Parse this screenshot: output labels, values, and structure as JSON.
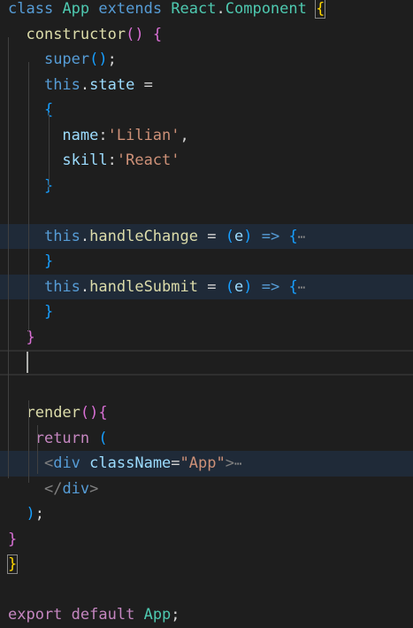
{
  "editor": {
    "lines": [
      [
        [
          "kw-blue",
          "class"
        ],
        [
          "pun",
          " "
        ],
        [
          "cls",
          "App"
        ],
        [
          "pun",
          " "
        ],
        [
          "kw-blue",
          "extends"
        ],
        [
          "pun",
          " "
        ],
        [
          "cls",
          "React"
        ],
        [
          "pun",
          "."
        ],
        [
          "cls",
          "Component"
        ],
        [
          "pun",
          " "
        ],
        [
          "br1 box",
          "{"
        ]
      ],
      [
        [
          "pun",
          "  "
        ],
        [
          "fn",
          "constructor"
        ],
        [
          "br2",
          "()"
        ],
        [
          "pun",
          " "
        ],
        [
          "br2",
          "{"
        ]
      ],
      [
        [
          "pun",
          "    "
        ],
        [
          "kw-blue",
          "super"
        ],
        [
          "br3",
          "()"
        ],
        [
          "pun",
          ";"
        ]
      ],
      [
        [
          "pun",
          "    "
        ],
        [
          "kw-blue",
          "this"
        ],
        [
          "pun",
          "."
        ],
        [
          "var",
          "state"
        ],
        [
          "pun",
          " ="
        ]
      ],
      [
        [
          "pun",
          "    "
        ],
        [
          "br3",
          "{"
        ]
      ],
      [
        [
          "pun",
          "      "
        ],
        [
          "var",
          "name"
        ],
        [
          "pun",
          ":"
        ],
        [
          "str",
          "'Lilian'"
        ],
        [
          "pun",
          ","
        ]
      ],
      [
        [
          "pun",
          "      "
        ],
        [
          "var",
          "skill"
        ],
        [
          "pun",
          ":"
        ],
        [
          "str",
          "'React'"
        ]
      ],
      [
        [
          "pun",
          "    "
        ],
        [
          "br3",
          "}"
        ]
      ],
      [],
      [
        [
          "pun",
          "    "
        ],
        [
          "kw-blue",
          "this"
        ],
        [
          "pun",
          "."
        ],
        [
          "fn",
          "handleChange"
        ],
        [
          "pun",
          " = "
        ],
        [
          "br3",
          "("
        ],
        [
          "var",
          "e"
        ],
        [
          "br3",
          ")"
        ],
        [
          "pun",
          " "
        ],
        [
          "kw-blue",
          "=>"
        ],
        [
          "pun",
          " "
        ],
        [
          "br3",
          "{"
        ],
        [
          "ell",
          "⋯"
        ]
      ],
      [
        [
          "pun",
          "    "
        ],
        [
          "br3",
          "}"
        ]
      ],
      [
        [
          "pun",
          "    "
        ],
        [
          "kw-blue",
          "this"
        ],
        [
          "pun",
          "."
        ],
        [
          "fn",
          "handleSubmit"
        ],
        [
          "pun",
          " = "
        ],
        [
          "br3",
          "("
        ],
        [
          "var",
          "e"
        ],
        [
          "br3",
          ")"
        ],
        [
          "pun",
          " "
        ],
        [
          "kw-blue",
          "=>"
        ],
        [
          "pun",
          " "
        ],
        [
          "br3",
          "{"
        ],
        [
          "ell",
          "⋯"
        ]
      ],
      [
        [
          "pun",
          "    "
        ],
        [
          "br3",
          "}"
        ]
      ],
      [
        [
          "pun",
          "  "
        ],
        [
          "br2",
          "}"
        ]
      ],
      [],
      [],
      [
        [
          "pun",
          "  "
        ],
        [
          "fn",
          "render"
        ],
        [
          "br2",
          "()"
        ],
        [
          "br2",
          "{"
        ]
      ],
      [
        [
          "pun",
          "   "
        ],
        [
          "kw-pink",
          "return"
        ],
        [
          "pun",
          " "
        ],
        [
          "br3",
          "("
        ]
      ],
      [
        [
          "pun",
          "    "
        ],
        [
          "tagp",
          "<"
        ],
        [
          "kw-blue",
          "div"
        ],
        [
          "pun",
          " "
        ],
        [
          "var",
          "className"
        ],
        [
          "pun",
          "="
        ],
        [
          "str",
          "\"App\""
        ],
        [
          "tagp",
          ">"
        ],
        [
          "ell",
          "⋯"
        ]
      ],
      [
        [
          "pun",
          "    "
        ],
        [
          "tagp",
          "</"
        ],
        [
          "kw-blue",
          "div"
        ],
        [
          "tagp",
          ">"
        ]
      ],
      [
        [
          "pun",
          "  "
        ],
        [
          "br3",
          ")"
        ],
        [
          "pun",
          ";"
        ]
      ],
      [
        [
          "br2",
          "}"
        ]
      ],
      [
        [
          "br1 box",
          "}"
        ]
      ],
      [],
      [
        [
          "kw-pink",
          "export"
        ],
        [
          "pun",
          " "
        ],
        [
          "kw-pink",
          "default"
        ],
        [
          "pun",
          " "
        ],
        [
          "cls",
          "App"
        ],
        [
          "pun",
          ";"
        ]
      ]
    ],
    "highlighted_lines": [
      9,
      11,
      18
    ],
    "current_line": 14,
    "tokens_sample": {
      "keyword_class": "class",
      "class_name": "App",
      "state_name": "Lilian",
      "state_skill": "React"
    },
    "colors": {
      "background": "#1e1e1e",
      "keyword": "#569cd6",
      "control_keyword": "#c586c0",
      "type": "#4ec9b0",
      "function": "#dcdcaa",
      "variable": "#9cdcfe",
      "string": "#ce9178"
    }
  }
}
